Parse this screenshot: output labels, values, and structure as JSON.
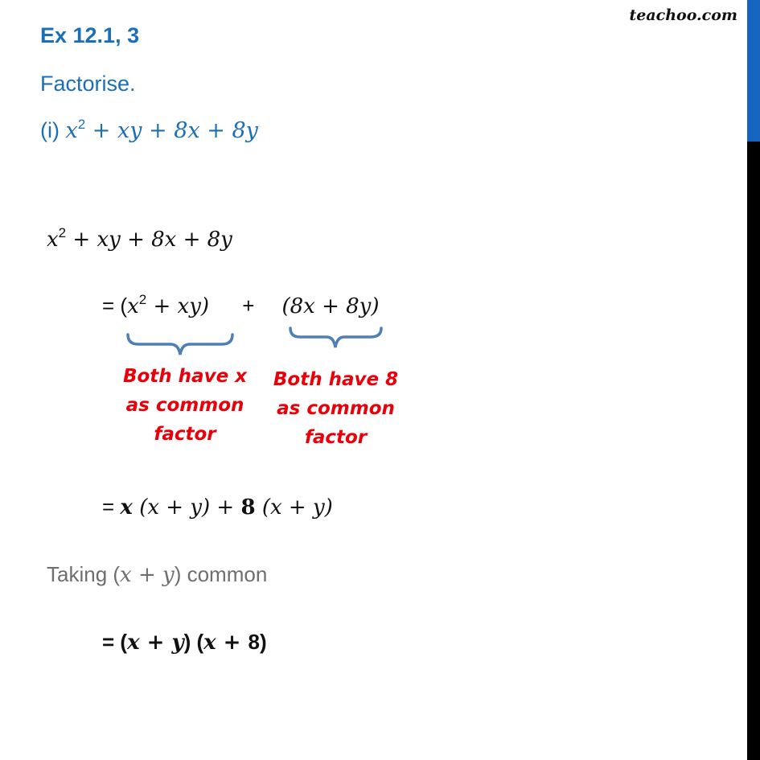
{
  "header": {
    "title": "Ex 12.1, 3",
    "instruction": "Factorise.",
    "question_label": "(i)",
    "question_expr": [
      "x",
      "2",
      " + xy + 8x + 8y"
    ]
  },
  "watermark": "teachoo.com",
  "solution": {
    "step1": [
      "x",
      "2",
      " + xy + 8x + 8y"
    ],
    "step2": {
      "prefix": "= (",
      "group1_a": "x",
      "group1_sup": "2",
      "group1_b": " + xy)",
      "plus": "+",
      "group2": "(8x + 8y)"
    },
    "annotations": [
      {
        "text": "Both have x as common factor",
        "color": "#e8000b"
      },
      {
        "text": "Both have 8 as common factor",
        "color": "#e8000b"
      }
    ],
    "step3": {
      "eq": "= ",
      "x_bold": "x",
      "part1": " (x + y) + ",
      "eight_bold": "8",
      "part2": " (x + y)"
    },
    "taking": {
      "before": "Taking (",
      "expr": "x + y",
      "after": ") common"
    },
    "step4": {
      "eq": "= (",
      "expr1": "x + y",
      "mid": ") (",
      "expr2": "x + ",
      "end": "8)"
    }
  },
  "colors": {
    "heading_blue": "#1a6fb7",
    "annotation_red": "#e8000b",
    "brace_blue": "#4f7fb5",
    "scroll_thumb": "#1565c0"
  }
}
